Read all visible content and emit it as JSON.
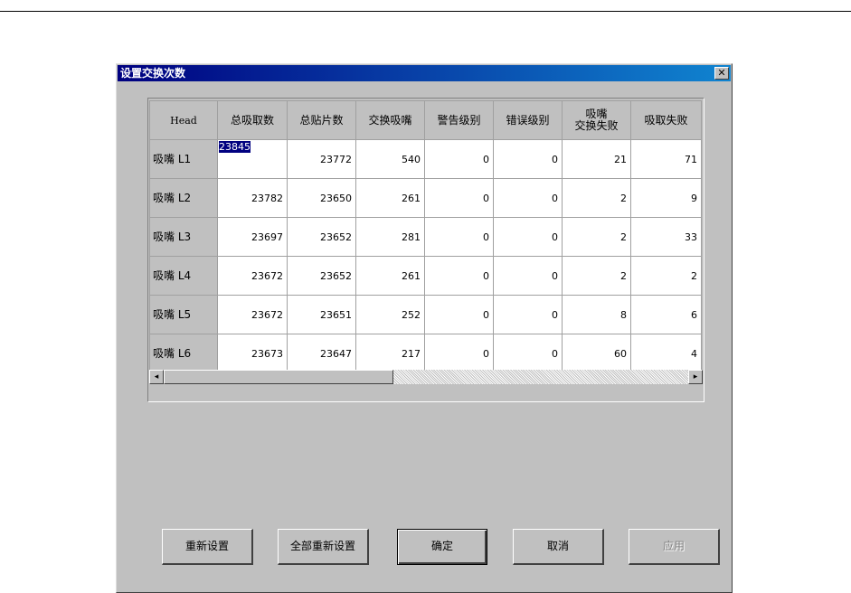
{
  "window": {
    "title": "设置交换次数",
    "close_label": "✕"
  },
  "grid": {
    "corner_header": "Head",
    "columns": [
      "总吸取数",
      "总贴片数",
      "交换吸嘴",
      "警告级别",
      "错误级别",
      "吸嘴\n交换失败",
      "吸取失败"
    ],
    "rows": [
      {
        "label": "吸嘴 L1",
        "values": [
          "23845",
          "23772",
          "540",
          "0",
          "0",
          "21",
          "71"
        ]
      },
      {
        "label": "吸嘴 L2",
        "values": [
          "23782",
          "23650",
          "261",
          "0",
          "0",
          "2",
          "9"
        ]
      },
      {
        "label": "吸嘴 L3",
        "values": [
          "23697",
          "23652",
          "281",
          "0",
          "0",
          "2",
          "33"
        ]
      },
      {
        "label": "吸嘴 L4",
        "values": [
          "23672",
          "23652",
          "261",
          "0",
          "0",
          "2",
          "2"
        ]
      },
      {
        "label": "吸嘴 L5",
        "values": [
          "23672",
          "23651",
          "252",
          "0",
          "0",
          "8",
          "6"
        ]
      },
      {
        "label": "吸嘴 L6",
        "values": [
          "23673",
          "23647",
          "217",
          "0",
          "0",
          "60",
          "4"
        ]
      }
    ],
    "selected_cell": {
      "row": 0,
      "col": 0
    }
  },
  "scrollbar": {
    "left_arrow": "◂",
    "right_arrow": "▸"
  },
  "buttons": {
    "reset": "重新设置",
    "reset_all": "全部重新设置",
    "ok": "确定",
    "cancel": "取消",
    "apply": "应用"
  }
}
